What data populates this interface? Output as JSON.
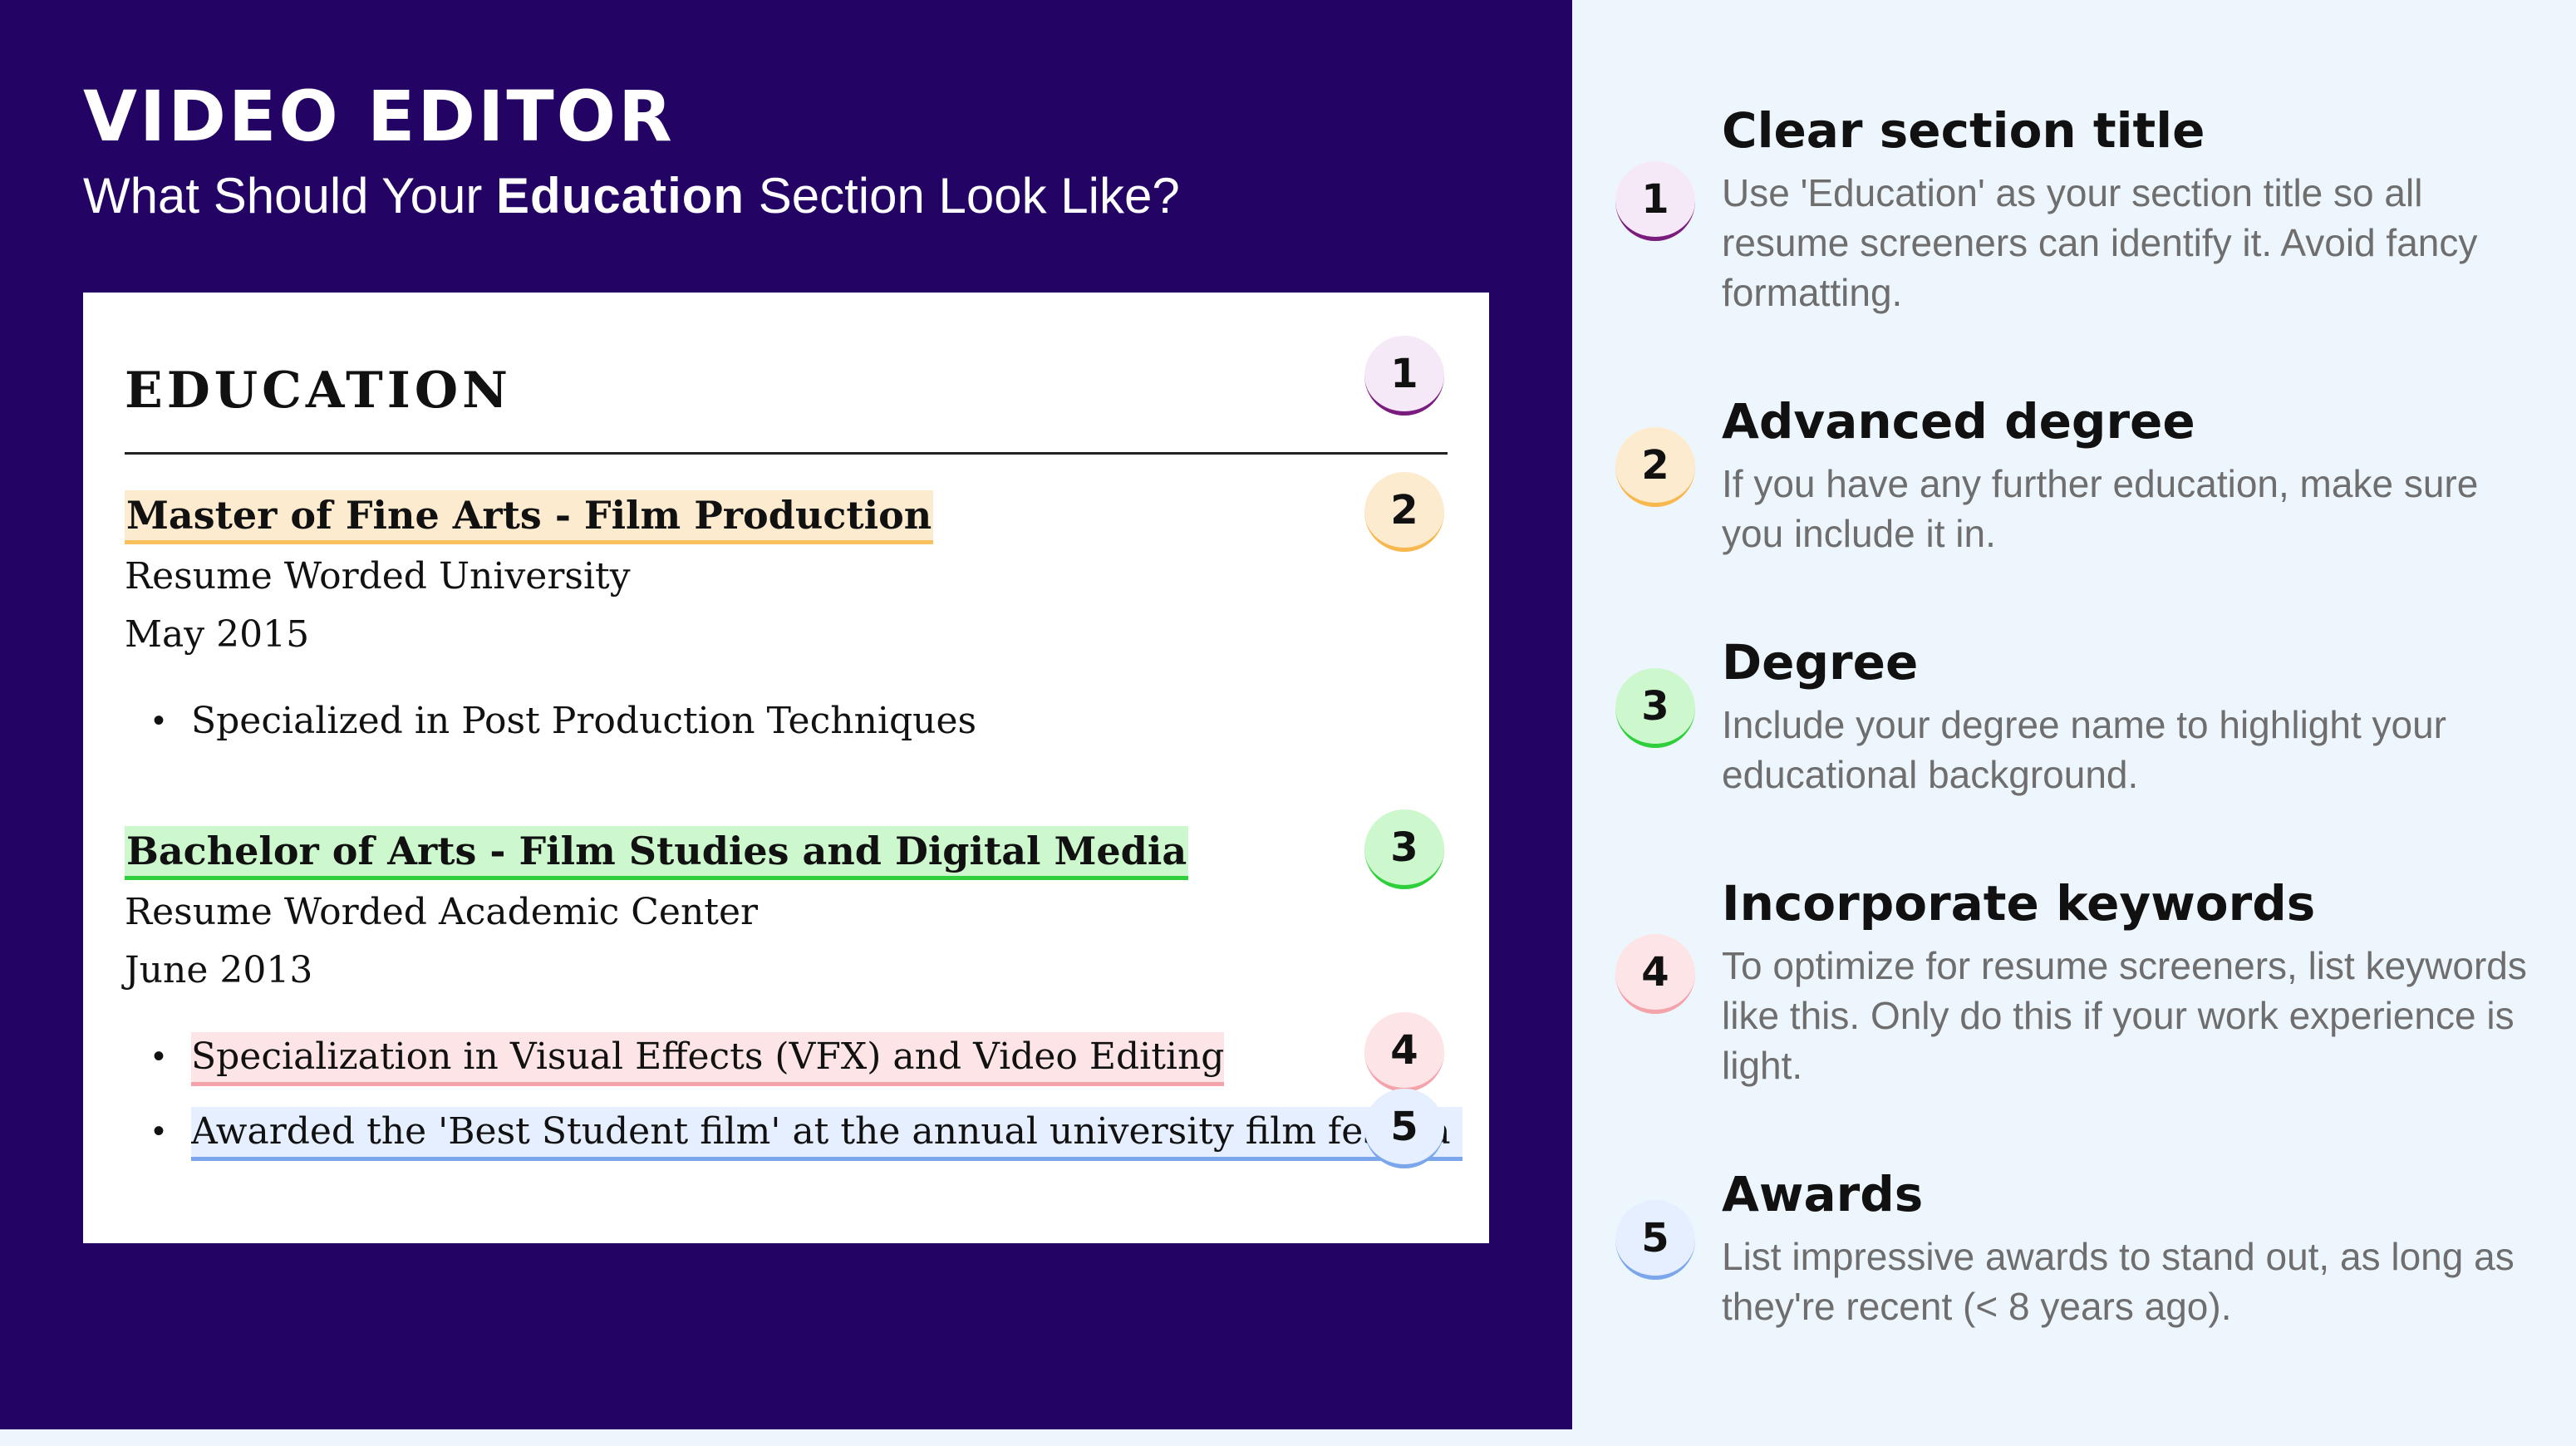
{
  "header": {
    "role_title": "VIDEO EDITOR",
    "subtitle_before": "What Should Your ",
    "subtitle_bold": "Education",
    "subtitle_after": " Section Look Like?"
  },
  "resume": {
    "section_title": "EDUCATION",
    "entries": [
      {
        "degree": "Master of Fine Arts - Film Production",
        "school": "Resume Worded University",
        "date": "May 2015",
        "bullets": [
          "Specialized in Post Production Techniques"
        ]
      },
      {
        "degree": "Bachelor of Arts - Film Studies and Digital Media",
        "school": "Resume Worded Academic Center",
        "date": "June 2013",
        "bullets": [
          "Specialization in Visual Effects (VFX) and Video Editing",
          "Awarded the 'Best Student film' at the annual university film festiva"
        ]
      }
    ],
    "bullet_char": "•"
  },
  "badges": [
    "1",
    "2",
    "3",
    "4",
    "5"
  ],
  "tips": [
    {
      "number": "1",
      "title": "Clear section title",
      "body": "Use 'Education' as your section title so all resume screeners can identify it. Avoid fancy formatting."
    },
    {
      "number": "2",
      "title": "Advanced degree",
      "body": "If you have any further education, make sure you include it in."
    },
    {
      "number": "3",
      "title": "Degree",
      "body": "Include your degree name to highlight your educational background."
    },
    {
      "number": "4",
      "title": "Incorporate keywords",
      "body": "To optimize for resume screeners, list keywords like this. Only do this if your work experience is light."
    },
    {
      "number": "5",
      "title": "Awards",
      "body": "List impressive awards to stand out, as long as they're recent (< 8 years ago)."
    }
  ],
  "colors": {
    "background_dark": "#230464",
    "panel_light": "#eef6fd",
    "highlight_1": "#7a1c7d",
    "highlight_2": "#f7b84f",
    "highlight_3": "#2fcf3b",
    "highlight_4": "#f3a3a9",
    "highlight_5": "#7ba6eb"
  }
}
